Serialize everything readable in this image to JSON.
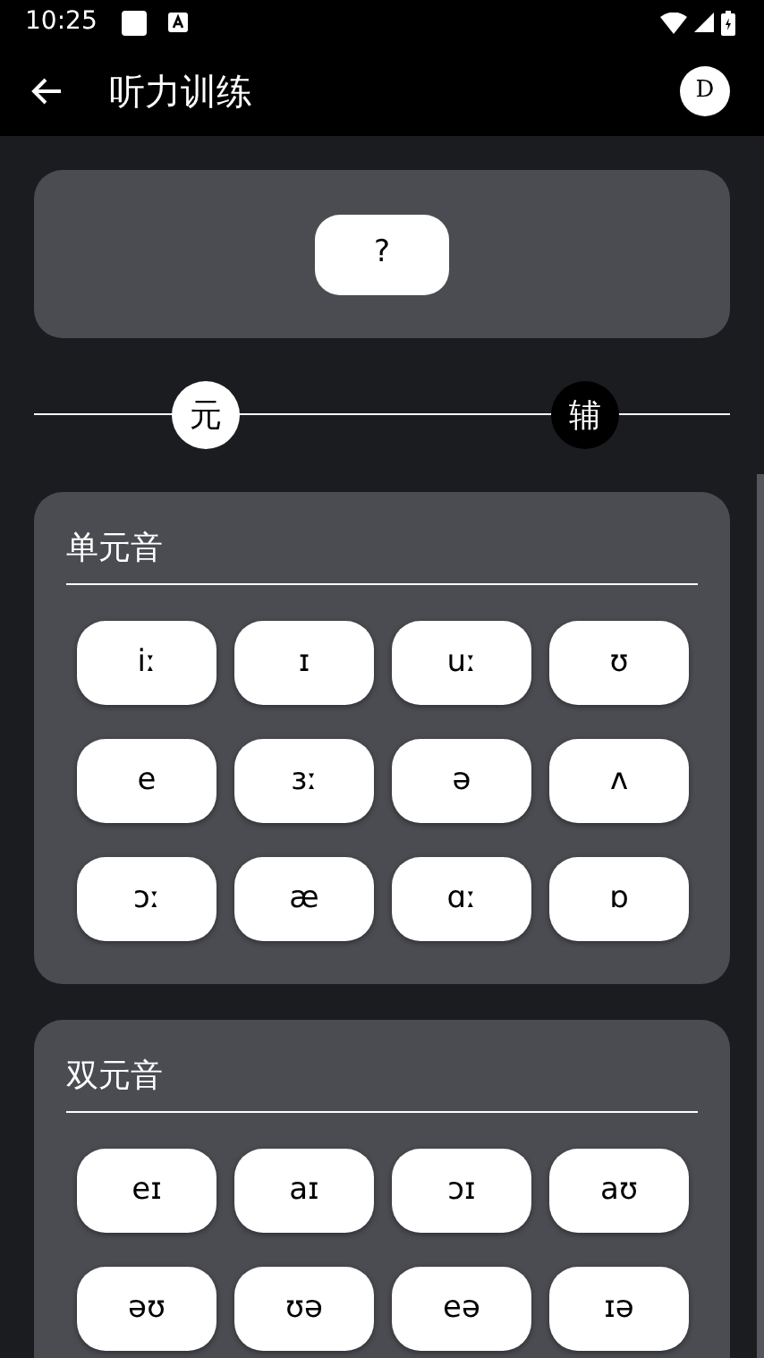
{
  "status_bar": {
    "time": "10:25"
  },
  "app_bar": {
    "title": "听力训练",
    "avatar": "D"
  },
  "question": {
    "label": "?"
  },
  "toggle": {
    "options": [
      {
        "label": "元",
        "selected": true
      },
      {
        "label": "辅",
        "selected": false
      }
    ]
  },
  "sections": [
    {
      "title": "单元音",
      "sounds": [
        "iː",
        "ɪ",
        "uː",
        "ʊ",
        "e",
        "ɜː",
        "ə",
        "ʌ",
        "ɔː",
        "æ",
        "ɑː",
        "ɒ"
      ]
    },
    {
      "title": "双元音",
      "sounds": [
        "eɪ",
        "aɪ",
        "ɔɪ",
        "aʊ",
        "əʊ",
        "ʊə",
        "eə",
        "ɪə"
      ]
    }
  ]
}
